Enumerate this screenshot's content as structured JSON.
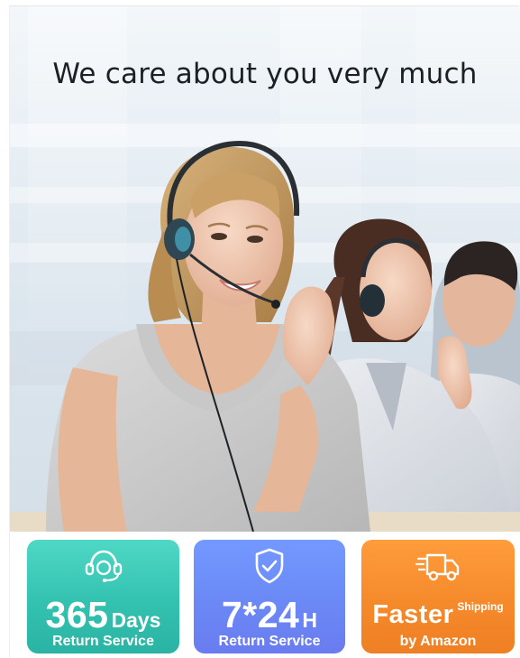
{
  "banner": {
    "headline": "We care about you very much"
  },
  "features": [
    {
      "icon": "headset-support-icon",
      "big": "365",
      "suffix": "Days",
      "sublabel": "Return Service",
      "color": "#36c4b2"
    },
    {
      "icon": "shield-check-icon",
      "big": "7*24",
      "suffix": "H",
      "sublabel": "Return Service",
      "color": "#6c88f4"
    },
    {
      "icon": "delivery-truck-icon",
      "big": "Faster",
      "suffix": "Shipping",
      "sublabel": "by Amazon",
      "color": "#f3862a"
    }
  ]
}
